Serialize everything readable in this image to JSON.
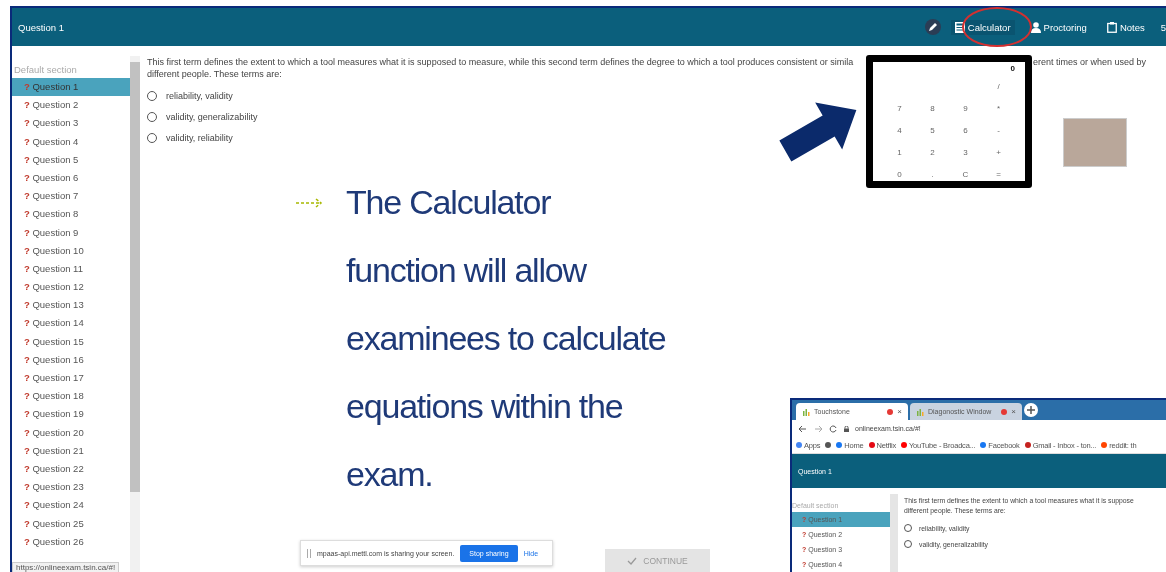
{
  "header": {
    "title": "Question 1",
    "tools": [
      {
        "kind": "pen"
      },
      {
        "kind": "calculator",
        "label": "Calculator",
        "highlighted": true
      },
      {
        "kind": "person",
        "label": "Proctoring",
        "highlighted": false
      },
      {
        "kind": "notes",
        "label": "Notes",
        "highlighted": false
      },
      {
        "kind": "text",
        "label": "5"
      }
    ]
  },
  "sidebar": {
    "section": "Default section",
    "items": [
      {
        "mark": "?",
        "label": "Question 1",
        "selected": true
      },
      {
        "mark": "?",
        "label": "Question 2",
        "selected": false
      },
      {
        "mark": "?",
        "label": "Question 3",
        "selected": false
      },
      {
        "mark": "?",
        "label": "Question 4",
        "selected": false
      },
      {
        "mark": "?",
        "label": "Question 5",
        "selected": false
      },
      {
        "mark": "?",
        "label": "Question 6",
        "selected": false
      },
      {
        "mark": "?",
        "label": "Question 7",
        "selected": false
      },
      {
        "mark": "?",
        "label": "Question 8",
        "selected": false
      },
      {
        "mark": "?",
        "label": "Question 9",
        "selected": false
      },
      {
        "mark": "?",
        "label": "Question 10",
        "selected": false
      },
      {
        "mark": "?",
        "label": "Question 11",
        "selected": false
      },
      {
        "mark": "?",
        "label": "Question 12",
        "selected": false
      },
      {
        "mark": "?",
        "label": "Question 13",
        "selected": false
      },
      {
        "mark": "?",
        "label": "Question 14",
        "selected": false
      },
      {
        "mark": "?",
        "label": "Question 15",
        "selected": false
      },
      {
        "mark": "?",
        "label": "Question 16",
        "selected": false
      },
      {
        "mark": "?",
        "label": "Question 17",
        "selected": false
      },
      {
        "mark": "?",
        "label": "Question 18",
        "selected": false
      },
      {
        "mark": "?",
        "label": "Question 19",
        "selected": false
      },
      {
        "mark": "?",
        "label": "Question 20",
        "selected": false
      },
      {
        "mark": "?",
        "label": "Question 21",
        "selected": false
      },
      {
        "mark": "?",
        "label": "Question 22",
        "selected": false
      },
      {
        "mark": "?",
        "label": "Question 23",
        "selected": false
      },
      {
        "mark": "?",
        "label": "Question 24",
        "selected": false
      },
      {
        "mark": "?",
        "label": "Question 25",
        "selected": false
      },
      {
        "mark": "?",
        "label": "Question 26",
        "selected": false
      }
    ],
    "status_url": "https://onlineexam.tsin.ca/#!"
  },
  "question": {
    "text_left": "This first term defines the extent to which a tool measures what it is supposed to measure, while this second term defines the degree to which a tool produces consistent or simila",
    "text_right": "erent times or when used by",
    "text_end": "different people. These terms are:",
    "options": [
      {
        "label": "reliability, validity",
        "selected": false
      },
      {
        "label": "validity, generalizability",
        "selected": false
      },
      {
        "label": "validity, reliability",
        "selected": false
      }
    ]
  },
  "calculator": {
    "display": "0",
    "keys": [
      "/",
      "7",
      "8",
      "9",
      "*",
      "4",
      "5",
      "6",
      "-",
      "1",
      "2",
      "3",
      "+",
      "0",
      ".",
      "C",
      "="
    ]
  },
  "callout": {
    "text": "The Calculator\nfunction will allow\nexaminees to calculate\nequations within the\nexam."
  },
  "sharing_bar": {
    "message": "mpaas-api.mettl.com is sharing your screen.",
    "stop_button": "Stop sharing",
    "hide_link": "Hide"
  },
  "continue_button": {
    "label": "CONTINUE",
    "disabled": true
  },
  "inset": {
    "tabs": [
      {
        "title": "Touchstone",
        "close": "×",
        "selected": true
      },
      {
        "title": "Diagonostic Window",
        "close": "×",
        "selected": false
      }
    ],
    "url": "onlineexam.tsin.ca/#!",
    "bookmarks": [
      {
        "kind": "apps",
        "label": "Apps"
      },
      {
        "kind": "globe"
      },
      {
        "kind": "facebook",
        "label": "Home"
      },
      {
        "kind": "netflix",
        "label": "Netflix"
      },
      {
        "kind": "youtube",
        "label": "YouTube - Broadca..."
      },
      {
        "kind": "facebook",
        "label": "Facebook"
      },
      {
        "kind": "gmail",
        "label": "Gmail - Inbox - ton..."
      },
      {
        "kind": "reddit",
        "label": "reddit: th"
      }
    ],
    "header_title": "Question 1",
    "section": "Default section",
    "items": [
      {
        "mark": "?",
        "label": "Question 1",
        "selected": true
      },
      {
        "mark": "?",
        "label": "Question 2",
        "selected": false
      },
      {
        "mark": "?",
        "label": "Question 3",
        "selected": false
      },
      {
        "mark": "?",
        "label": "Question 4",
        "selected": false
      }
    ],
    "question_text": "This first term defines the extent to which a tool measures what it is suppose\ndifferent people. These terms are:",
    "options": [
      {
        "label": "reliability, validity",
        "selected": false
      },
      {
        "label": "validity, generalizability",
        "selected": false
      }
    ]
  }
}
